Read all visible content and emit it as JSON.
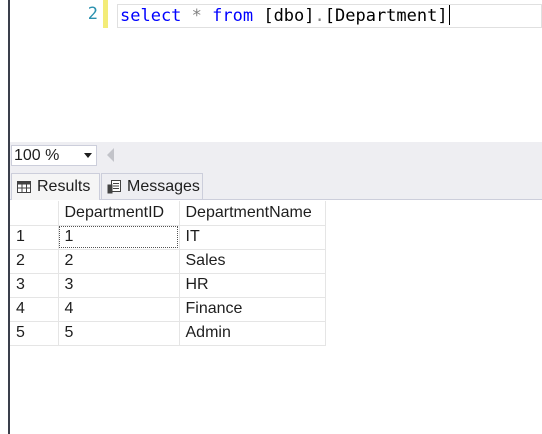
{
  "editor": {
    "line_number": "2",
    "code": {
      "kw1": "select",
      "star": " * ",
      "kw2": "from",
      "schema": " [dbo]",
      "dot": ".",
      "table": "[Department]"
    }
  },
  "zoom": {
    "value": "100 %"
  },
  "tabs": [
    {
      "label": "Results",
      "icon": "grid-icon"
    },
    {
      "label": "Messages",
      "icon": "messages-icon"
    }
  ],
  "grid": {
    "columns": [
      "DepartmentID",
      "DepartmentName"
    ],
    "rows": [
      {
        "num": "1",
        "id": "1",
        "name": "IT"
      },
      {
        "num": "2",
        "id": "2",
        "name": "Sales"
      },
      {
        "num": "3",
        "id": "3",
        "name": "HR"
      },
      {
        "num": "4",
        "id": "4",
        "name": "Finance"
      },
      {
        "num": "5",
        "id": "5",
        "name": "Admin"
      }
    ]
  },
  "colors": {
    "keyword": "#0000ff",
    "line_number": "#2b91af",
    "change_marker": "#f3ec78",
    "toolbar_bg": "#eeeef2"
  }
}
